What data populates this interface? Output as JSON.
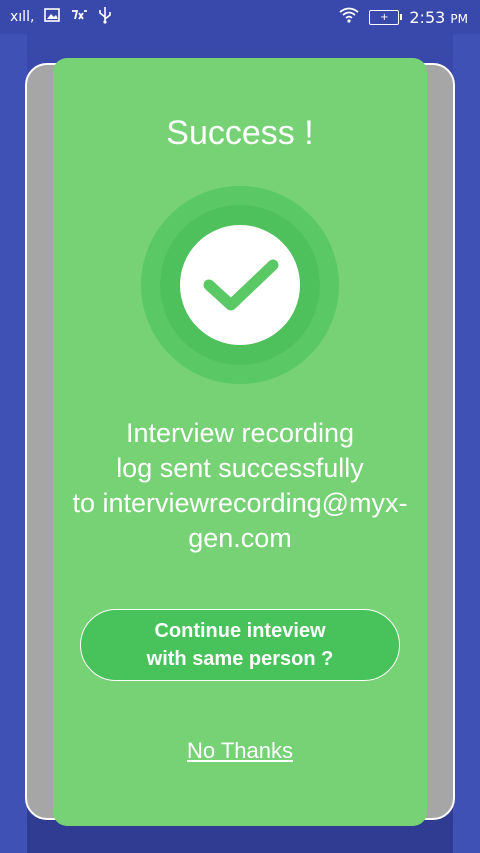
{
  "status_bar": {
    "signal_label": "xıll,",
    "time": "2:53",
    "time_suffix": "PM"
  },
  "dialog": {
    "title": "Success !",
    "message_lines": [
      "Interview recording",
      "log sent successfully",
      "to interviewrecording@myx-",
      "gen.com"
    ],
    "continue_button": {
      "line1": "Continue inteview",
      "line2": "with same person ?"
    },
    "no_thanks_label": "No Thanks"
  },
  "colors": {
    "dialog_green": "#76d275",
    "button_green": "#48c25a",
    "status_bar": "#3949ab"
  },
  "icons": [
    "image-icon",
    "call-icon",
    "usb-icon",
    "wifi-icon",
    "battery-icon",
    "checkmark-icon"
  ]
}
